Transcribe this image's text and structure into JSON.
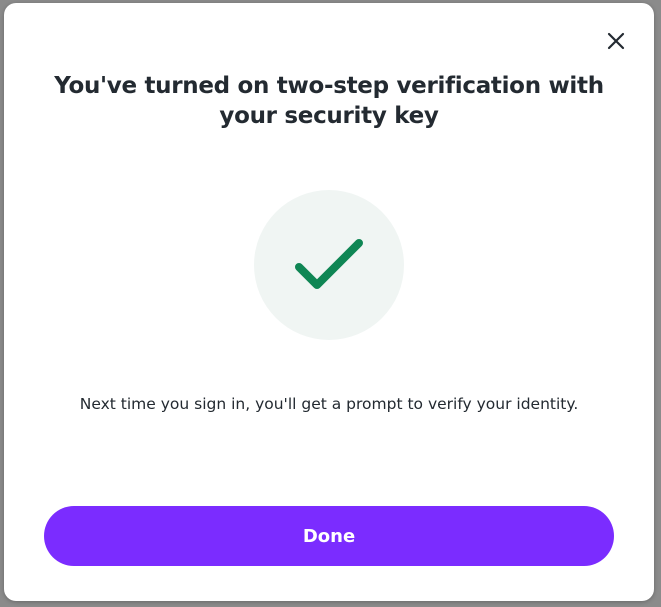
{
  "dialog": {
    "title": "You've turned on two-step verification with your security key",
    "message": "Next time you sign in, you'll get a prompt to verify your identity.",
    "done_label": "Done",
    "close_icon": "close-icon",
    "status_icon": "checkmark-icon"
  },
  "colors": {
    "accent": "#7b2cff",
    "success": "#0f8654",
    "success_bg": "#f0f5f3",
    "text": "#232a31"
  }
}
